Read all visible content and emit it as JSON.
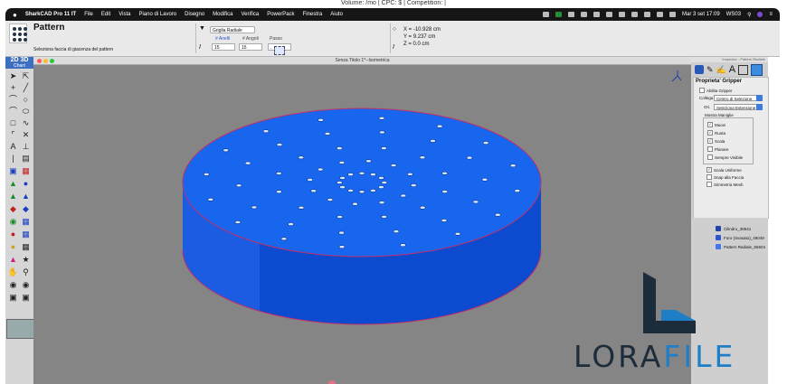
{
  "top_strip": {
    "text": "Volume:      /mo | CPC: $    | Competition:    |"
  },
  "menubar": {
    "apple_icon": "apple-icon",
    "app_name": "SharkCAD Pro 11 IT",
    "items": [
      "File",
      "Edit",
      "Vista",
      "Piano di Lavoro",
      "Disegno",
      "Modifica",
      "Verifica",
      "PowerPack",
      "Finestra",
      "Aiuto"
    ],
    "clock": "Mar 3 set 17:09",
    "host": "WS03"
  },
  "options_bar": {
    "title": "Pattern",
    "hint": "Seleziona faccia di giacenza del pattern",
    "pattern_select": "Griglia Radiale",
    "labels": {
      "anelli": "# Anelli",
      "angoli": "# Angoli",
      "passo": "Passo"
    },
    "values": {
      "anelli": "15",
      "angoli": "15",
      "passo": "."
    },
    "coords": {
      "x": "X = -10.928 cm",
      "y": "Y = 9.237 cm",
      "z": "Z = 0.0 cm"
    }
  },
  "document": {
    "title": "Senza Titolo 1*--Isometrica"
  },
  "toolbar": {
    "mode_2d3d": "2D 3D",
    "sub": "Chart"
  },
  "right_panel": {
    "titlebar": "Inspector - Pattern Radiale",
    "heading": "Proprieta' Gripper",
    "abilita": "Abilita Gripper",
    "collega_label": "Collega",
    "collega_value": "Centro di Selezione",
    "ori_label": "Ori.",
    "ori_value": "Seleziona Estensione",
    "section": "Mostra Maniglie",
    "handles": [
      {
        "label": "Muovi",
        "checked": "✓"
      },
      {
        "label": "Ruota",
        "checked": "✓"
      },
      {
        "label": "Scala",
        "checked": "✓"
      },
      {
        "label": "Planare",
        "checked": ""
      },
      {
        "label": "Sempre Visibile",
        "checked": ""
      }
    ],
    "options": [
      {
        "label": "Scala Uniforme",
        "checked": "✓"
      },
      {
        "label": "Snap alla Faccia",
        "checked": ""
      },
      {
        "label": "Simmetria Mesh",
        "checked": ""
      }
    ],
    "tree": [
      "Cilindro_38541",
      "Foro (Svasato)_49049",
      "Pattern Radiale_65604"
    ]
  },
  "logo": {
    "text_a": "LORA",
    "text_b": "FILE"
  },
  "colors": {
    "part": "#1560e8",
    "part_dark": "#0a3fc0",
    "viewport_bg": "#858585",
    "logo_blue": "#1f7fc6",
    "logo_dark": "#1d2c3a"
  }
}
